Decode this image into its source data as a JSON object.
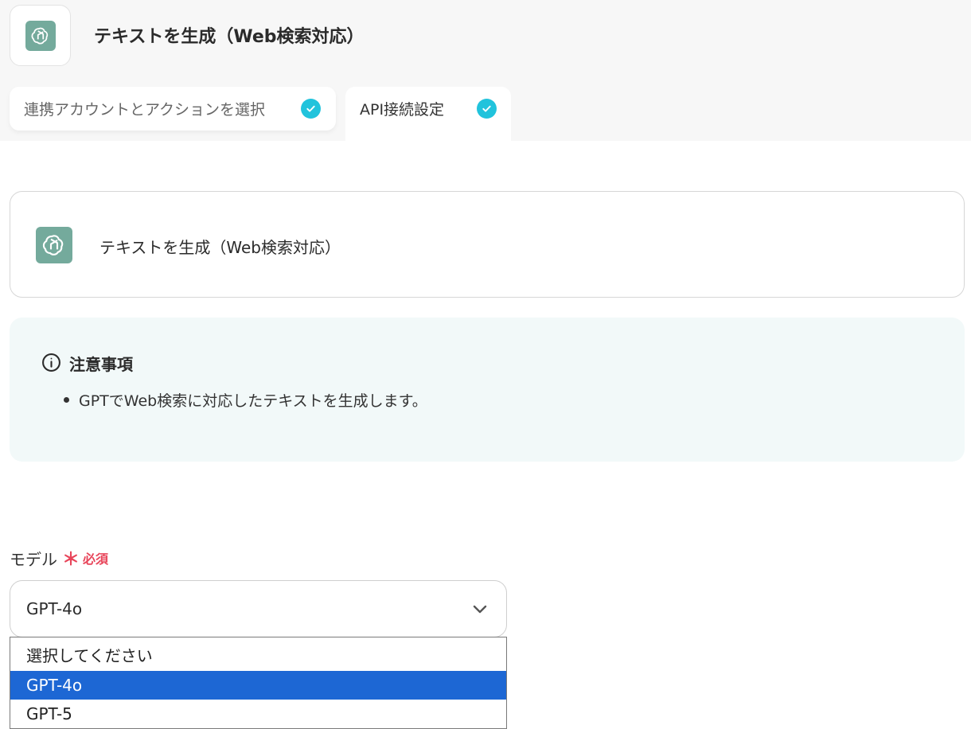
{
  "header": {
    "title": "テキストを生成（Web検索対応）",
    "icon": "openai-gpt-icon"
  },
  "tabs": [
    {
      "label": "連携アカウントとアクションを選択",
      "completed": true
    },
    {
      "label": "API接続設定",
      "completed": true,
      "active": true
    }
  ],
  "action_card": {
    "title": "テキストを生成（Web検索対応）",
    "icon": "openai-gpt-icon"
  },
  "notice": {
    "title": "注意事項",
    "items": [
      "GPTでWeb検索に対応したテキストを生成します。"
    ]
  },
  "model_field": {
    "label": "モデル",
    "required_mark": "＊",
    "required_text": "必須",
    "value": "GPT-4o",
    "options": [
      "選択してください",
      "GPT-4o",
      "GPT-5"
    ],
    "highlighted_option": "GPT-4o"
  },
  "colors": {
    "accent_check": "#21c3dc",
    "required": "#e8455a",
    "gpt_logo_bg": "#74aa9c",
    "option_highlight": "#1d67d4",
    "notice_bg": "#f2f9f9"
  }
}
